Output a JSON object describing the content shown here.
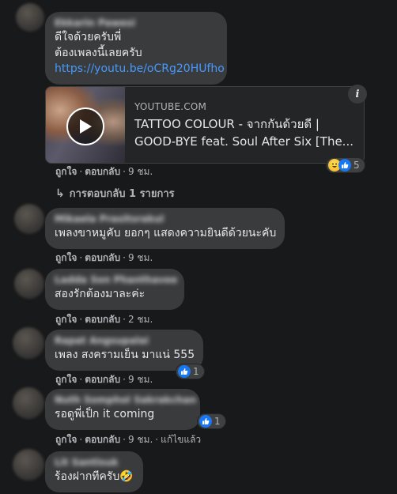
{
  "comments": [
    {
      "author": "Ekkarin Pawesi",
      "lines": [
        "ดีใจด้วยครับพี่",
        "ต้องเพลงนี้เลยครับ"
      ],
      "link_text": "https://youtu.be/oCRg20HUfho",
      "link_preview": {
        "domain": "YOUTUBE.COM",
        "title_line1": "TATTOO COLOUR - จากกันด้วยดี |",
        "title_line2": "GOOD-BYE feat. Soul After Six [The...",
        "thumbnail_icon": "play-icon",
        "info_icon": "info-icon",
        "info_label": "i"
      },
      "reactions": {
        "icons": [
          "haha-icon",
          "like-icon"
        ],
        "count": "5"
      },
      "actions": {
        "like": "ถูกใจ",
        "reply": "ตอบกลับ",
        "time": "9 ชม."
      },
      "view_replies": "การตอบกลับ 1 รายการ"
    },
    {
      "author": "Mikaela Prasitsrakul",
      "text": "เพลงขาหมูคับ ยอกๆ แสดงความยินดีด้วยนะคับ",
      "actions": {
        "like": "ถูกใจ",
        "reply": "ตอบกลับ",
        "time": "9 ชม."
      }
    },
    {
      "author": "Ladda Son Phanthavee",
      "text": "สองรักต้องมาละค่ะ",
      "actions": {
        "like": "ถูกใจ",
        "reply": "ตอบกลับ",
        "time": "2 ชม."
      }
    },
    {
      "author": "Rapat Angsupalai",
      "text": "เพลง สงครามเย็น มาแน่ 555",
      "reactions": {
        "icons": [
          "like-icon"
        ],
        "count": "1"
      },
      "actions": {
        "like": "ถูกใจ",
        "reply": "ตอบกลับ",
        "time": "9 ชม."
      }
    },
    {
      "author": "Nuth Somphol Sakrakchan",
      "text": "รอดูพี่เป็ก it coming",
      "reactions": {
        "icons": [
          "like-icon"
        ],
        "count": "1"
      },
      "actions": {
        "like": "ถูกใจ",
        "reply": "ตอบกลับ",
        "time": "9 ชม.",
        "edited": "แก้ไขแล้ว"
      }
    },
    {
      "author": "Lit Santisuk",
      "text": "ร้องฝากทีครับ🤣",
      "actions": {}
    }
  ],
  "colors": {
    "background": "#18191a",
    "bubble": "#3a3b3c",
    "link": "#4599ff",
    "like_blue": "#1877f2"
  }
}
